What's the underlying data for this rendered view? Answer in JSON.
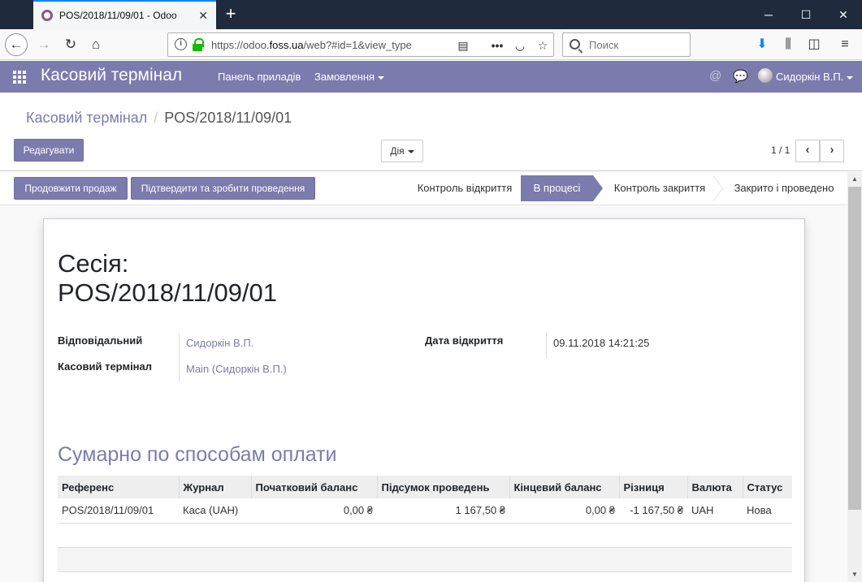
{
  "browser": {
    "tab_title": "POS/2018/11/09/01 - Odoo",
    "url_host": "https://odoo.",
    "url_domain": "foss.ua",
    "url_path": "/web?#id=1&view_type",
    "search_placeholder": "Поиск"
  },
  "topbar": {
    "app_title": "Касовий термінал",
    "menu_dashboard": "Панель приладів",
    "menu_orders": "Замовлення",
    "user_name": "Сидоркін В.П."
  },
  "control": {
    "breadcrumb_parent": "Касовий термінал",
    "breadcrumb_current": "POS/2018/11/09/01",
    "edit_button": "Редагувати",
    "action_button": "Дія",
    "pager": "1 / 1"
  },
  "statusbar": {
    "continue_button": "Продовжити продаж",
    "validate_button": "Підтвердити та зробити проведення",
    "stages": [
      "Контроль відкриття",
      "В процесі",
      "Контроль закриття",
      "Закрито і проведено"
    ]
  },
  "form": {
    "title_line1": "Сесія:",
    "title_line2": "POS/2018/11/09/01",
    "responsible_label": "Відповідальний",
    "responsible_value": "Сидоркін В.П.",
    "pos_label": "Касовий термінал",
    "pos_value": "Main (Сидоркін В.П.)",
    "open_date_label": "Дата відкриття",
    "open_date_value": "09.11.2018 14:21:25",
    "section_title": "Сумарно по способам оплати"
  },
  "table": {
    "headers": [
      "Референс",
      "Журнал",
      "Початковий баланс",
      "Підсумок проведень",
      "Кінцевий баланс",
      "Різниця",
      "Валюта",
      "Статус"
    ],
    "rows": [
      [
        "POS/2018/11/09/01",
        "Каса (UAH)",
        "0,00 ₴",
        "1 167,50 ₴",
        "0,00 ₴",
        "-1 167,50 ₴",
        "UAH",
        "Нова"
      ]
    ]
  },
  "colors": {
    "brand": "#7c7bad",
    "browser_tabbar": "#1f2a3d"
  }
}
